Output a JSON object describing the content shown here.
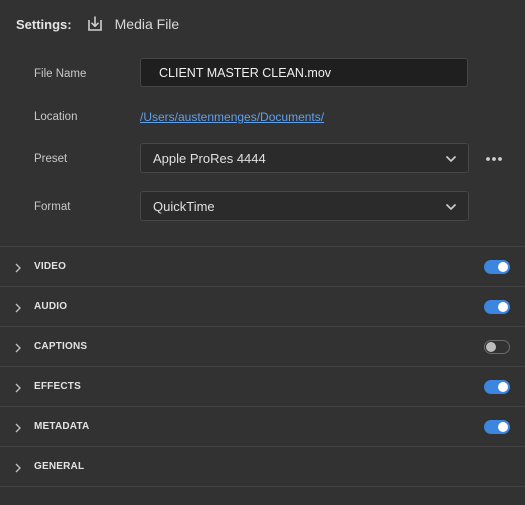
{
  "header": {
    "settings_label": "Settings:",
    "media_label": "Media File",
    "icon": "export-download-icon"
  },
  "fields": {
    "file_name": {
      "label": "File Name",
      "value": "CLIENT MASTER CLEAN.mov"
    },
    "location": {
      "label": "Location",
      "value": "/Users/austenmenges/Documents/"
    },
    "preset": {
      "label": "Preset",
      "value": "Apple ProRes 4444",
      "more_icon": "more-horizontal-icon"
    },
    "format": {
      "label": "Format",
      "value": "QuickTime"
    }
  },
  "sections": [
    {
      "label": "VIDEO",
      "toggle": true
    },
    {
      "label": "AUDIO",
      "toggle": true
    },
    {
      "label": "CAPTIONS",
      "toggle": false
    },
    {
      "label": "EFFECTS",
      "toggle": true
    },
    {
      "label": "METADATA",
      "toggle": true
    },
    {
      "label": "GENERAL",
      "toggle": null
    }
  ],
  "colors": {
    "background": "#323232",
    "accent": "#3c86e0",
    "link": "#5ea0ec",
    "divider": "#444444"
  }
}
